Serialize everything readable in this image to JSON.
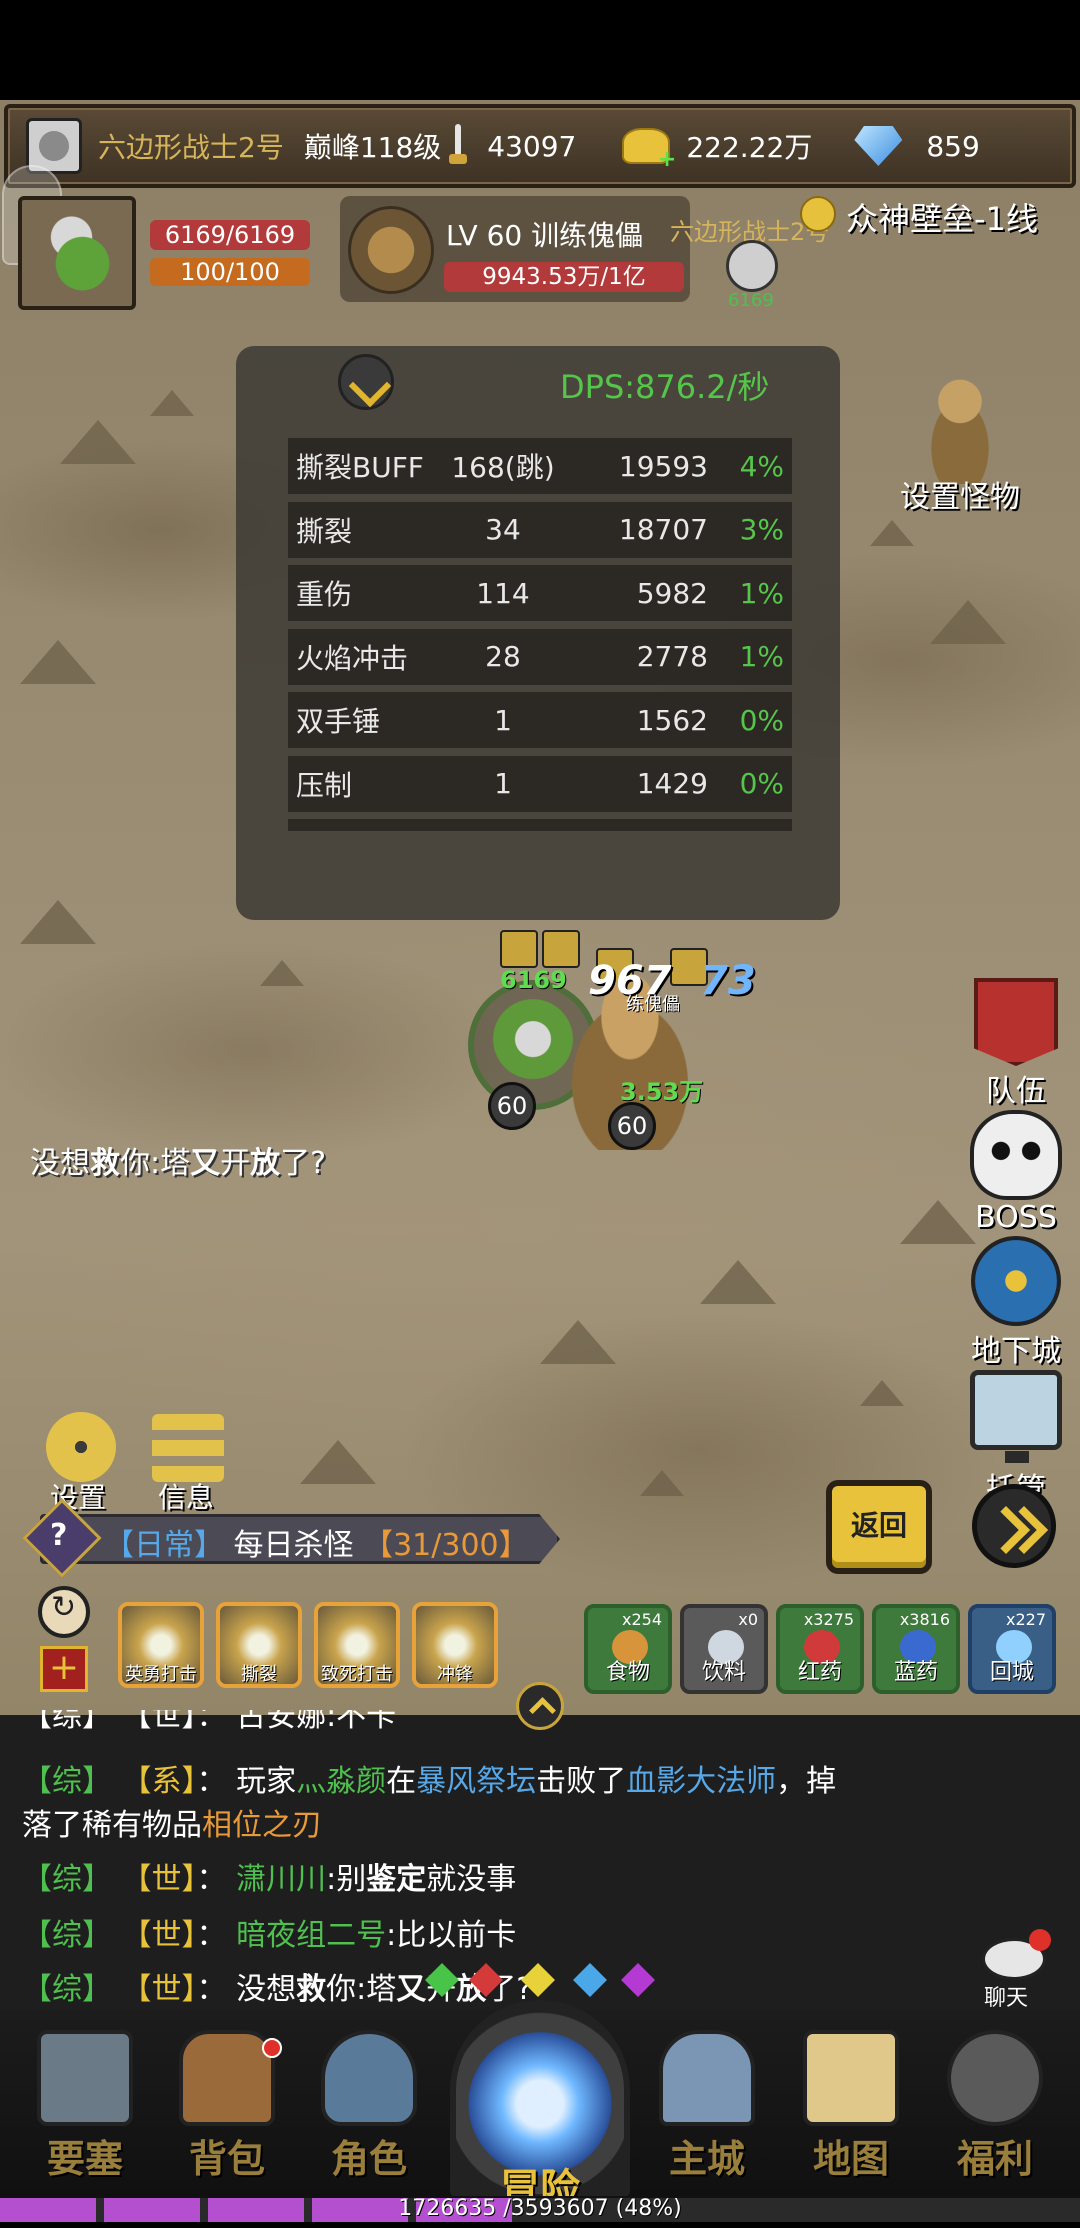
{
  "status_bar": {
    "player_name": "六边形战士2号",
    "level": "巅峰118级",
    "power": "43097",
    "gold": "222.22万",
    "diamonds": "859"
  },
  "player": {
    "hp": "6169/6169",
    "mp": "100/100"
  },
  "target": {
    "level_name": "LV 60 训练傀儡",
    "hp": "9943.53万/1亿",
    "owner_name": "六边形战士2号",
    "owner_hp": "6169"
  },
  "server": "众神壁垒-1线",
  "dps": {
    "title": "DPS:876.2/秒",
    "rows": [
      {
        "name": "撕裂BUFF",
        "hits": "168(跳)",
        "damage": "19593",
        "pct": "4%"
      },
      {
        "name": "撕裂",
        "hits": "34",
        "damage": "18707",
        "pct": "3%"
      },
      {
        "name": "重伤",
        "hits": "114",
        "damage": "5982",
        "pct": "1%"
      },
      {
        "name": "火焰冲击",
        "hits": "28",
        "damage": "2778",
        "pct": "1%"
      },
      {
        "name": "双手锤",
        "hits": "1",
        "damage": "1562",
        "pct": "0%"
      },
      {
        "name": "压制",
        "hits": "1",
        "damage": "1429",
        "pct": "0%"
      }
    ]
  },
  "side_menu": {
    "set_monster": "设置怪物",
    "team": "队伍",
    "boss": "BOSS",
    "dungeon": "地下城",
    "auto": "托管"
  },
  "battle": {
    "hero_hp": "6169",
    "damage_white": "967",
    "damage_blue": "73",
    "golem_hp": "3.53万",
    "golem_name": "练傀儡",
    "hero_level": "60",
    "golem_level": "60"
  },
  "map_chat": {
    "p1": "没想",
    "p2": "救",
    "p3": "你:塔",
    "p4": "又",
    "p5": "开",
    "p6": "放",
    "p7": "了?"
  },
  "utility": {
    "settings": "设置",
    "info": "信息"
  },
  "quest": {
    "tag": "【日常】",
    "name": "每日杀怪",
    "progress": "【31/300】"
  },
  "buttons": {
    "return": "返回"
  },
  "skills": [
    {
      "label": "英勇打击"
    },
    {
      "label": "撕裂"
    },
    {
      "label": "致死打击"
    },
    {
      "label": "冲锋"
    }
  ],
  "items": [
    {
      "label": "食物",
      "count": "x254"
    },
    {
      "label": "饮料",
      "count": "x0"
    },
    {
      "label": "红药",
      "count": "x3275"
    },
    {
      "label": "蓝药",
      "count": "x3816"
    },
    {
      "label": "回城",
      "count": "x227"
    }
  ],
  "chat": {
    "partial": "【综】 【世】： 古安娜:不卡",
    "line1": {
      "ch": "【综】",
      "type": "【系】",
      "sep": "：",
      "t1": "玩家",
      "player": "灬淼颜",
      "t2": "在",
      "place": "暴风祭坛",
      "t3": "击败了",
      "boss": "血影大法师",
      "t4": "，掉"
    },
    "line1b": {
      "t1": "落了稀有物品",
      "item": "相位之刃"
    },
    "line2": {
      "ch": "【综】",
      "type": "【世】",
      "sep": "：",
      "name": "潇川川",
      "t1": ":别",
      "bold": "鉴定",
      "t2": "就没事"
    },
    "line3": {
      "ch": "【综】",
      "type": "【世】",
      "sep": "：",
      "name": "暗夜组二号",
      "t1": ":比以前卡"
    },
    "line4": {
      "ch": "【综】",
      "type": "【世】",
      "sep": "：",
      "t1": "没想",
      "b1": "救",
      "t2": "你:塔",
      "b2": "又",
      "t3": "开",
      "b3": "放",
      "t4": "了?"
    },
    "chat_button": "聊天"
  },
  "nav": [
    {
      "label": "要塞"
    },
    {
      "label": "背包"
    },
    {
      "label": "角色"
    },
    {
      "label": "冒险"
    },
    {
      "label": "主城"
    },
    {
      "label": "地图"
    },
    {
      "label": "福利"
    }
  ],
  "exp": {
    "text": "1726635 /3593607 (48%)",
    "fraction": 0.48
  }
}
